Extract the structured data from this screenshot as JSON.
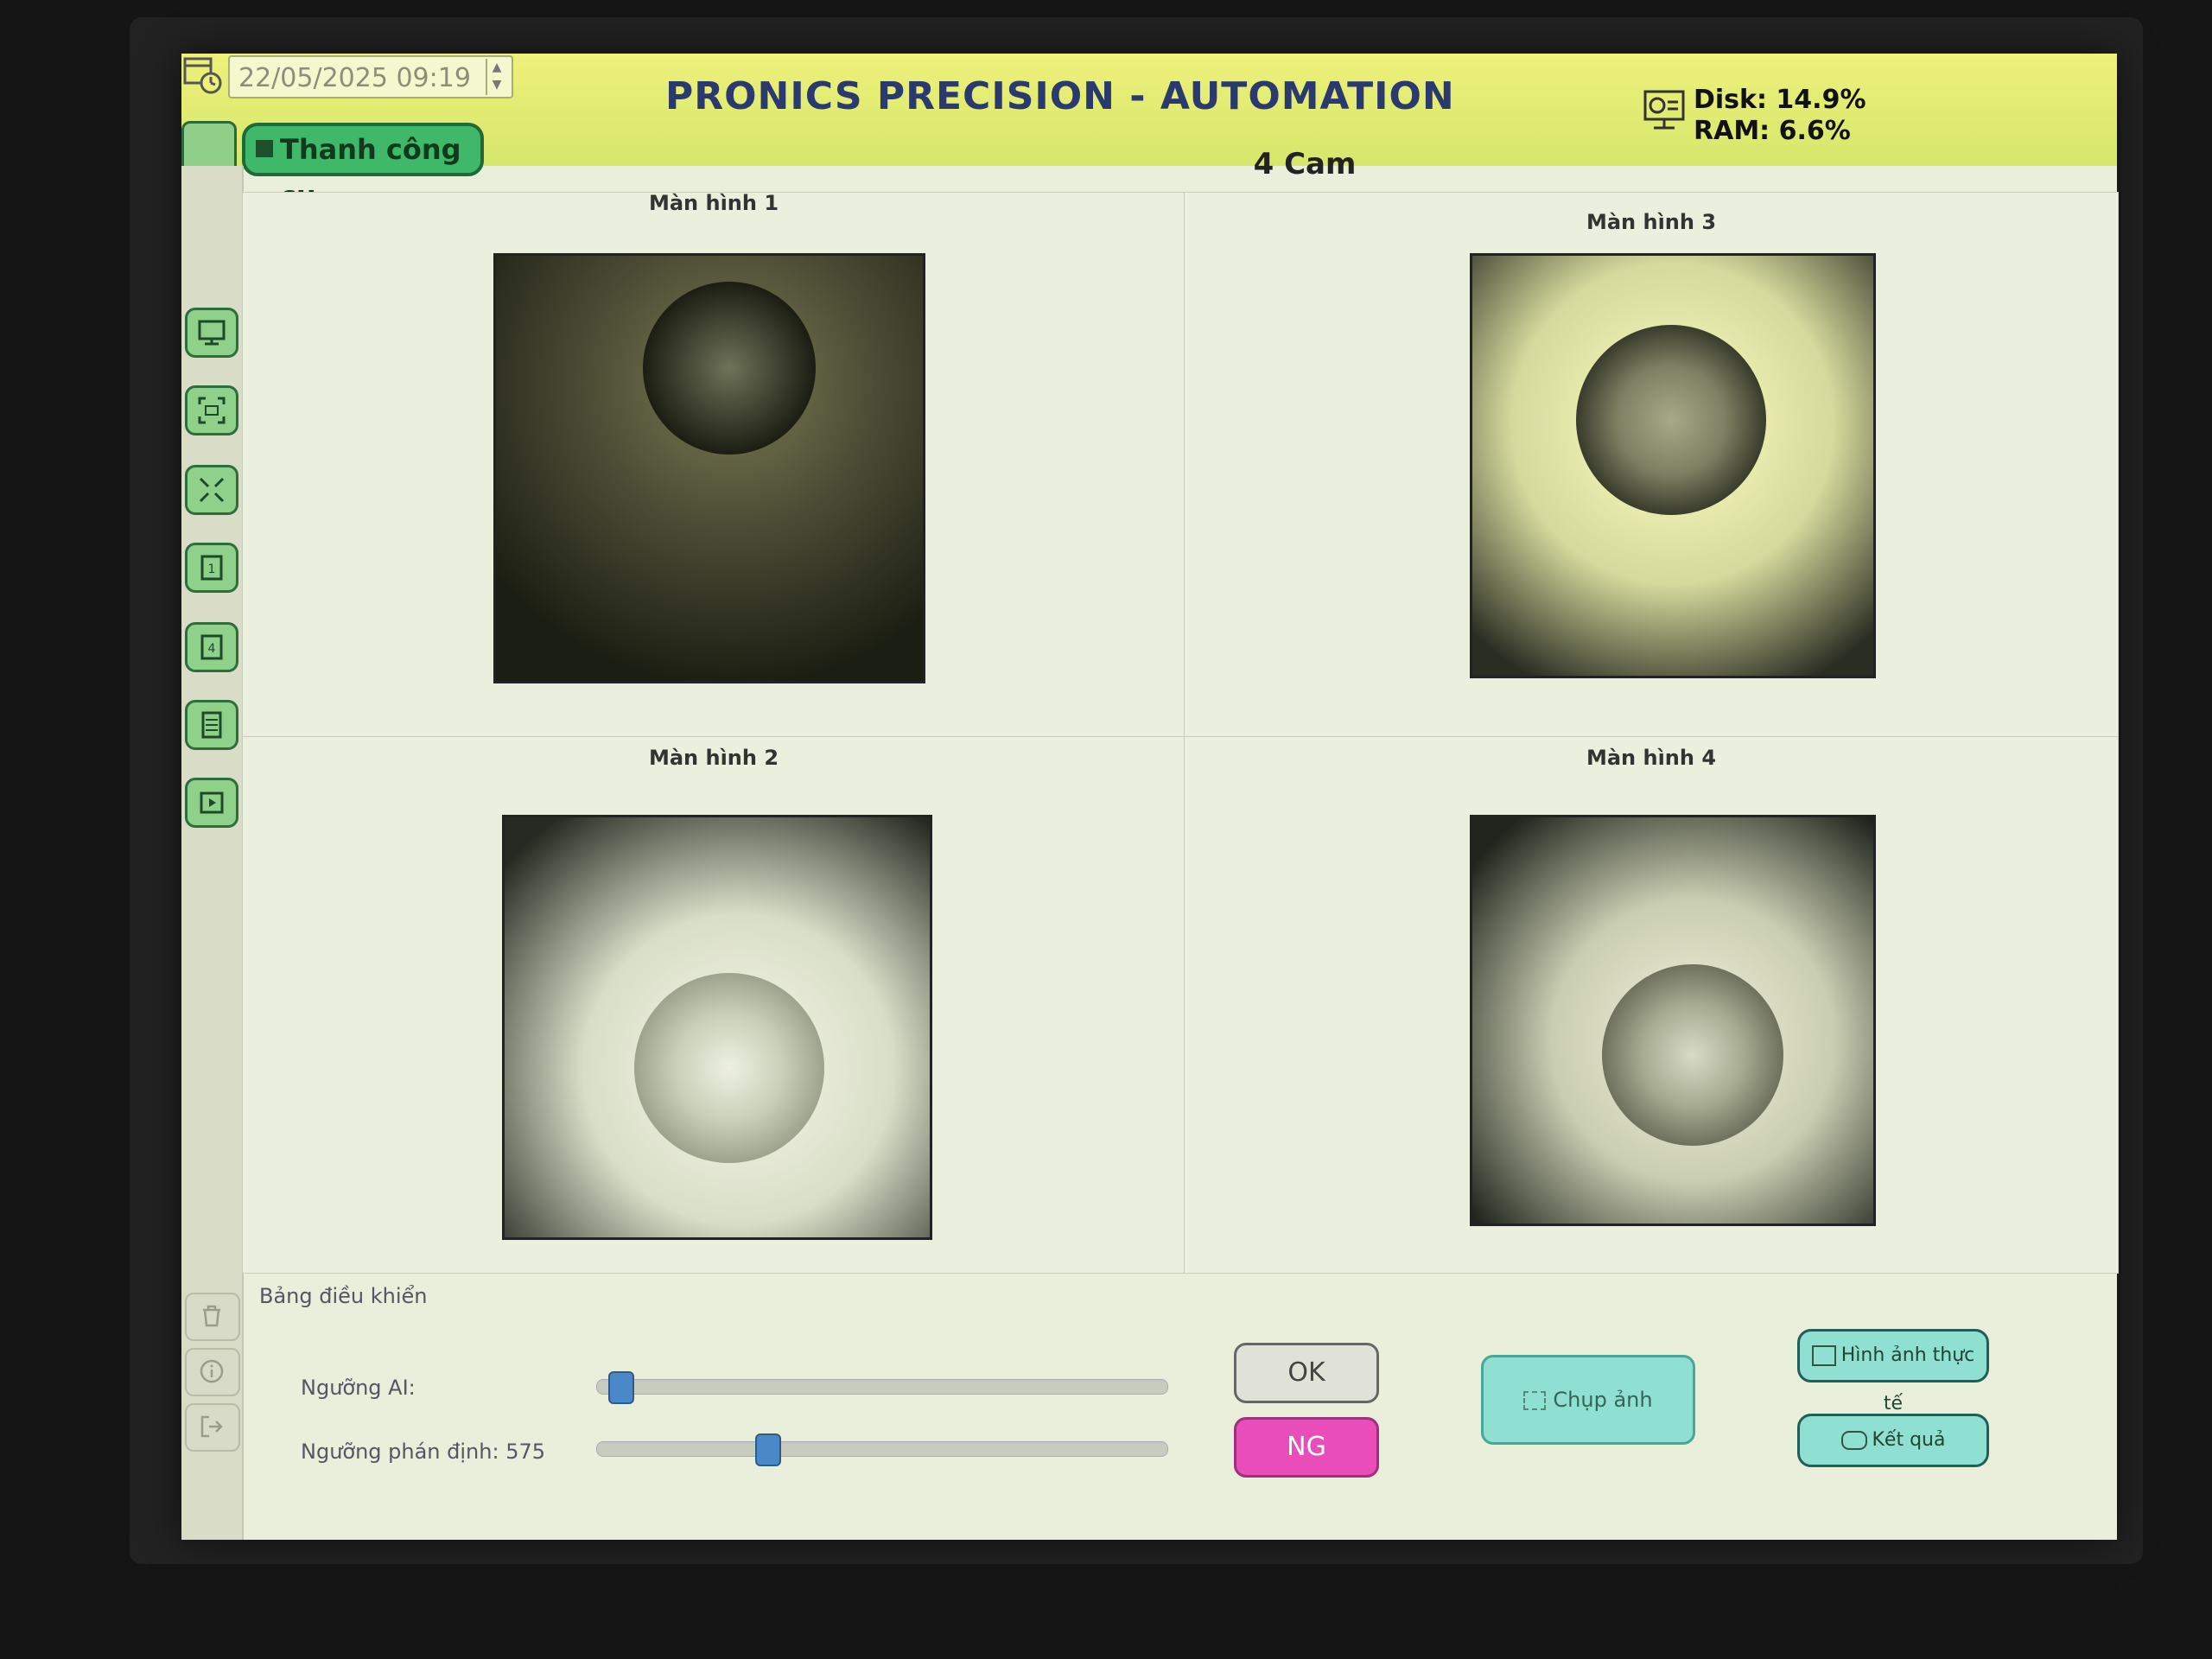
{
  "header": {
    "datetime": "22/05/2025 09:19",
    "title": "PRONICS PRECISION - AUTOMATION",
    "disk": "Disk: 14.9%",
    "ram": "RAM: 6.6%"
  },
  "toolbar": {
    "label": "Thanh công cụ"
  },
  "mode": "4 Cam",
  "screens": [
    {
      "title": "Màn hình  1"
    },
    {
      "title": "Màn hình  3"
    },
    {
      "title": "Màn hình  2"
    },
    {
      "title": "Màn hình  4"
    }
  ],
  "sidebar_icons": [
    "monitor-icon",
    "scan-icon",
    "collapse-icon",
    "layout-1-icon",
    "layout-4-icon",
    "list-icon",
    "media-icon"
  ],
  "bottom_icons": [
    "trash-icon",
    "info-icon",
    "exit-icon"
  ],
  "control_panel": {
    "title": "Bảng điều khiển",
    "ai_threshold_label": "Ngưỡng AI:",
    "ai_threshold_level": 0.02,
    "judge_threshold_label": "Ngưỡng phán định: 575",
    "judge_threshold_level": 0.29
  },
  "buttons": {
    "ok": "OK",
    "ng": "NG",
    "capture": "Chụp ảnh",
    "real_image": "Hình ảnh thực tế",
    "result": "Kết quả"
  },
  "colors": {
    "header": "#e4ee79",
    "ng": "#e84db9",
    "accent": "#8fdfd3",
    "toolbar_green": "#3fb86a"
  }
}
